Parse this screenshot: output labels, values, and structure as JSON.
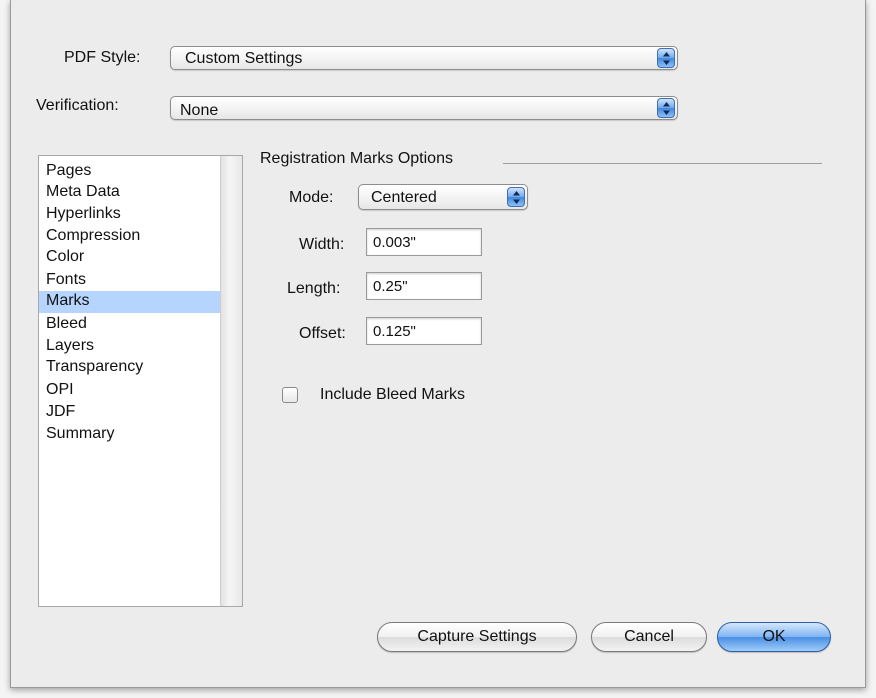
{
  "header": {
    "pdf_style_label": "PDF Style:",
    "pdf_style_value": "Custom Settings",
    "verification_label": "Verification:",
    "verification_value": "None"
  },
  "sidebar": {
    "selected": "Marks",
    "items": [
      {
        "label": "Pages"
      },
      {
        "label": "Meta Data"
      },
      {
        "label": "Hyperlinks"
      },
      {
        "label": "Compression"
      },
      {
        "label": "Color"
      },
      {
        "label": "Fonts"
      },
      {
        "label": "Marks"
      },
      {
        "label": "Bleed"
      },
      {
        "label": "Layers"
      },
      {
        "label": "Transparency"
      },
      {
        "label": "OPI"
      },
      {
        "label": "JDF"
      },
      {
        "label": "Summary"
      }
    ]
  },
  "marks": {
    "group_title": "Registration Marks Options",
    "mode_label": "Mode:",
    "mode_value": "Centered",
    "width_label": "Width:",
    "width_value": "0.003\"",
    "length_label": "Length:",
    "length_value": "0.25\"",
    "offset_label": "Offset:",
    "offset_value": "0.125\"",
    "include_bleed_label": "Include Bleed Marks",
    "include_bleed_checked": false
  },
  "buttons": {
    "capture": "Capture Settings",
    "cancel": "Cancel",
    "ok": "OK"
  },
  "colors": {
    "selection": "#b5d5ff",
    "accent_blue": "#4a8ee5"
  },
  "icons": {
    "popup_arrows": "up-down-arrows-icon",
    "checkbox": "checkbox-unchecked-icon"
  }
}
